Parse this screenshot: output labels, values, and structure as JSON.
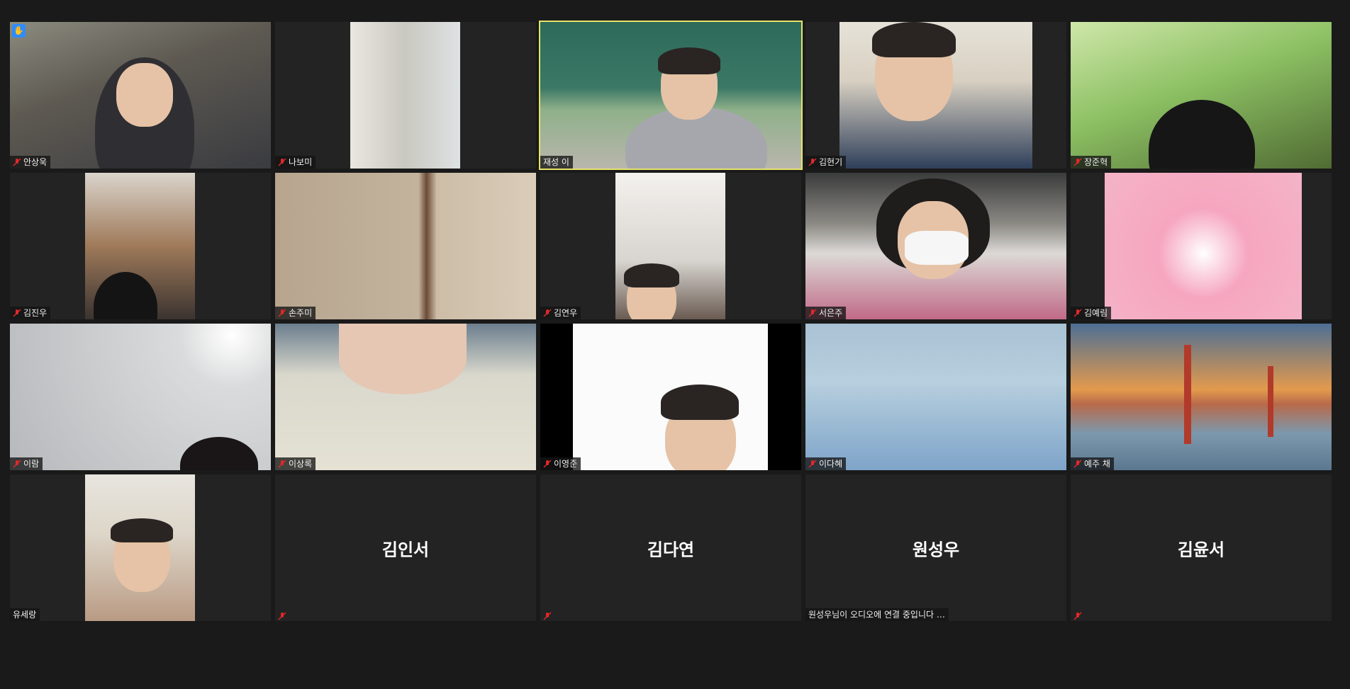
{
  "participants": [
    {
      "name": "안상욱",
      "muted": true,
      "hand_raised": true
    },
    {
      "name": "나보미",
      "muted": true
    },
    {
      "name": "재성 이",
      "muted": false,
      "active_speaker": true
    },
    {
      "name": "김현기",
      "muted": true
    },
    {
      "name": "장준혁",
      "muted": true
    },
    {
      "name": "김진우",
      "muted": true
    },
    {
      "name": "손주미",
      "muted": true
    },
    {
      "name": "김연우",
      "muted": true
    },
    {
      "name": "서은주",
      "muted": true
    },
    {
      "name": "김예림",
      "muted": true
    },
    {
      "name": "이람",
      "muted": true
    },
    {
      "name": "이상록",
      "muted": true
    },
    {
      "name": "이영준",
      "muted": true
    },
    {
      "name": "이다혜",
      "muted": true
    },
    {
      "name": "예주 채",
      "muted": true
    },
    {
      "name": "유세랑",
      "muted": false
    },
    {
      "name": "김인서",
      "muted": true,
      "video_off": true
    },
    {
      "name": "김다연",
      "muted": true,
      "video_off": true
    },
    {
      "name": "원성우",
      "video_off": true,
      "status": "원성우님이 오디오에 연결 중입니다 …"
    },
    {
      "name": "김윤서",
      "muted": true,
      "video_off": true
    }
  ],
  "colors": {
    "background": "#1a1a1a",
    "tile": "#232323",
    "active_speaker_border": "#e6e36a",
    "muted_icon": "#e02828",
    "raise_hand": "#2d8cff"
  },
  "icons": {
    "muted": "mic-off-icon",
    "hand": "raised-hand-icon"
  }
}
